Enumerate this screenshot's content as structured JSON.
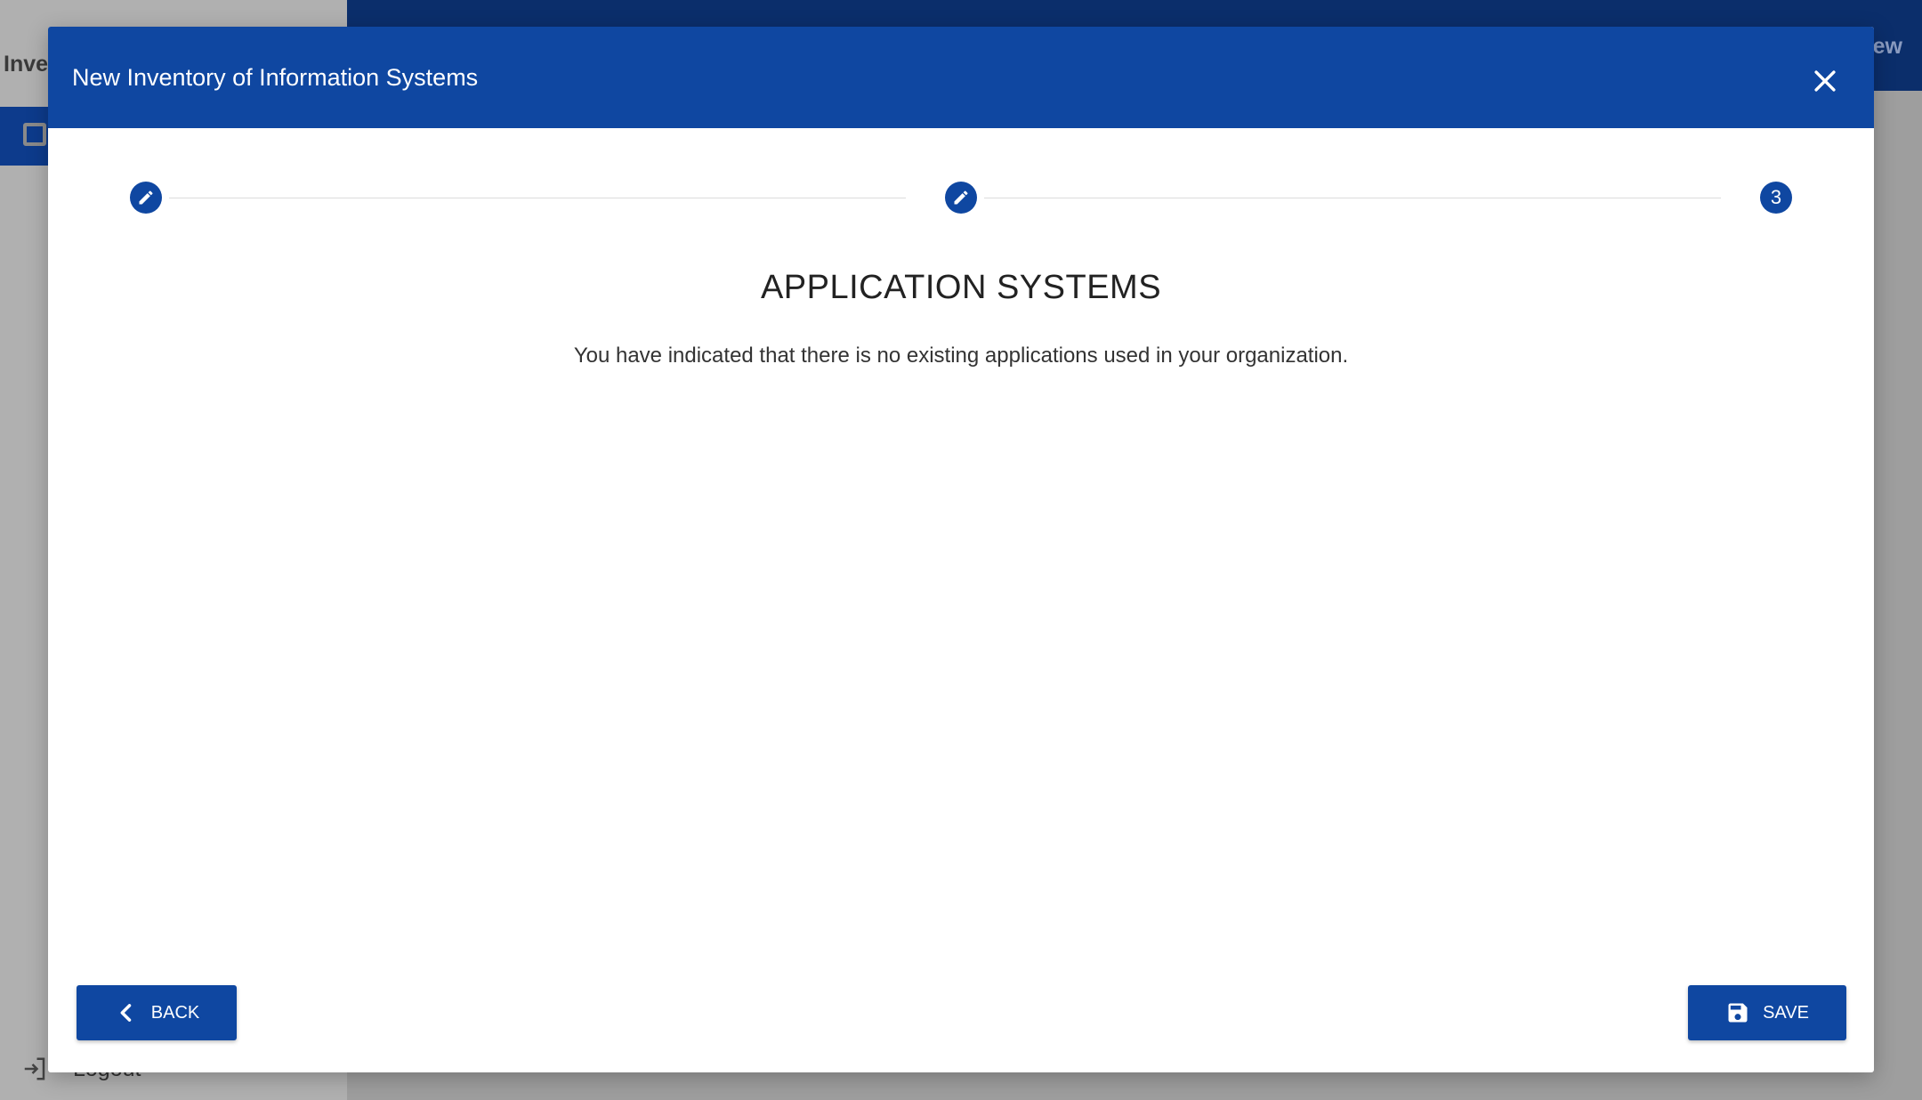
{
  "background": {
    "sidebar_title": "Inve",
    "logout_label": "Logout",
    "header_right_text": "ew"
  },
  "dialog": {
    "title": "New Inventory of Information Systems",
    "close_icon": "close-icon"
  },
  "stepper": {
    "steps": [
      {
        "state": "edit",
        "icon": "pencil-icon"
      },
      {
        "state": "edit",
        "icon": "pencil-icon"
      },
      {
        "state": "active",
        "label": "3"
      }
    ]
  },
  "content": {
    "heading": "APPLICATION SYSTEMS",
    "message": "You have indicated that there is no existing applications used in your organization."
  },
  "actions": {
    "back_label": "BACK",
    "save_label": "SAVE"
  },
  "colors": {
    "primary": "#0f47a1",
    "header_dark": "#0b2e6b"
  }
}
